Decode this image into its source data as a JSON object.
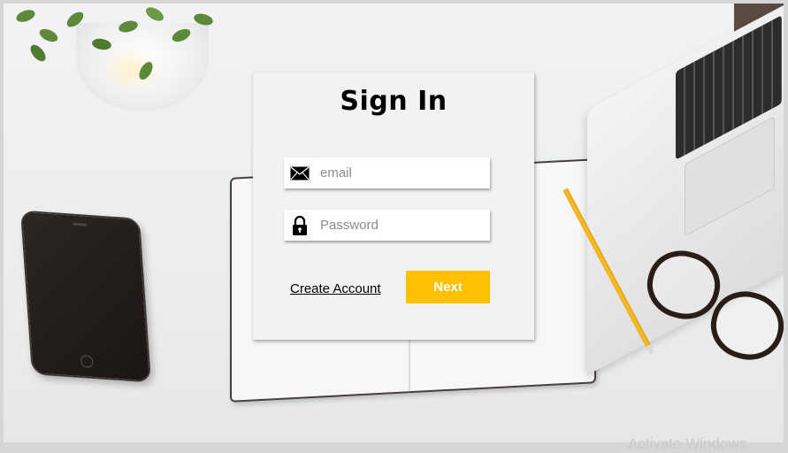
{
  "signin": {
    "title": "Sign In",
    "email_placeholder": "email",
    "password_placeholder": "Password",
    "create_account_label": "Create Account",
    "next_label": "Next"
  },
  "icons": {
    "email": "envelope-icon",
    "password": "lock-icon"
  },
  "colors": {
    "next_button": "#FFC000",
    "card_background": "#F2F2F2"
  },
  "watermark": "Activate Windows"
}
